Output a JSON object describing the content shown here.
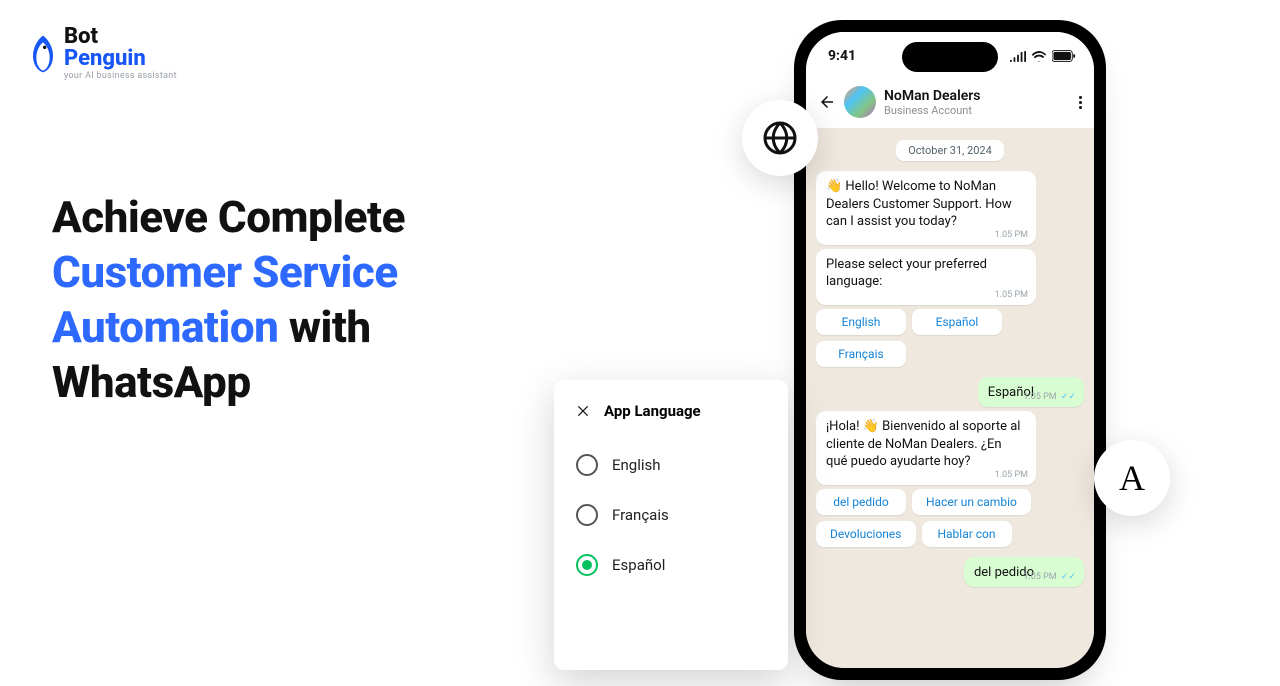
{
  "logo": {
    "top": "Bot",
    "bottom": "Penguin",
    "tag": "your AI business assistant"
  },
  "headline": {
    "pre": "Achieve Complete ",
    "blue": "Customer Service Automation",
    "post": " with WhatsApp"
  },
  "phone": {
    "time": "9:41",
    "wa": {
      "title": "NoMan Dealers",
      "subtitle": "Business Account"
    },
    "date": "October 31, 2024",
    "msg1": "👋 Hello! Welcome to NoMan Dealers Customer Support. How can I assist you today?",
    "msg1_time": "1.05 PM",
    "msg2": "Please select your preferred language:",
    "msg2_time": "1.05 PM",
    "opts1": [
      "English",
      "Español",
      "Français"
    ],
    "reply1": "Español",
    "reply1_time": "1.05 PM",
    "msg3": "¡Hola! 👋 Bienvenido al soporte al cliente de NoMan Dealers. ¿En qué puedo ayudarte hoy?",
    "msg3_time": "1.05 PM",
    "opts2": [
      "del pedido",
      "Hacer un cambio",
      "Devoluciones",
      "Hablar con"
    ],
    "reply2": "del pedido",
    "reply2_time": "1.05 PM"
  },
  "sheet": {
    "title": "App Language",
    "options": [
      "English",
      "Français",
      "Español"
    ],
    "selected": "Español"
  },
  "float": {
    "a_glyph": "A"
  }
}
